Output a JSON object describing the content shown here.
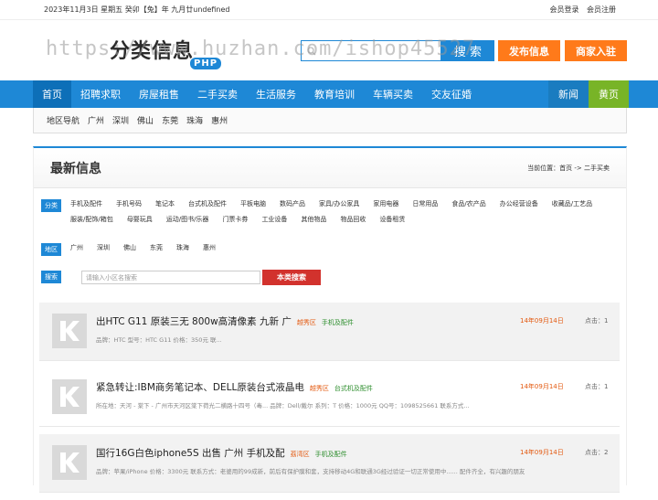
{
  "topbar": {
    "date": "2023年11月3日 星期五 癸卯【兔】年 九月廿undefined",
    "login": "会员登录",
    "register": "会员注册"
  },
  "header": {
    "logo_text": "分类信息",
    "logo_badge": "PHP",
    "watermark": "https://www.huzhan.com/ishop45527",
    "search_btn": "搜 索",
    "post_btn": "发布信息",
    "merchant_btn": "商家入驻"
  },
  "nav": {
    "items": [
      "首页",
      "招聘求职",
      "房屋租售",
      "二手买卖",
      "生活服务",
      "教育培训",
      "车辆买卖",
      "交友征婚"
    ],
    "news": "新闻",
    "home2": "黄页"
  },
  "region_nav": {
    "label": "地区导航",
    "items": [
      "广州",
      "深圳",
      "佛山",
      "东莞",
      "珠海",
      "惠州"
    ]
  },
  "panel": {
    "title": "最新信息",
    "crumb": "当前位置：首页 -> 二手买卖"
  },
  "filters": {
    "cat_tag": "分类",
    "categories": [
      "手机及配件",
      "手机号码",
      "笔记本",
      "台式机及配件",
      "平板电脑",
      "数码产品",
      "家具/办公家具",
      "家用电器",
      "日常用品",
      "食品/农产品",
      "办公经营设备",
      "收藏品/工艺品",
      "服装/配饰/箱包",
      "母婴玩具",
      "运动/图书/乐器",
      "门票卡券",
      "工业设备",
      "其他物品",
      "物品回收",
      "设备租赁"
    ],
    "area_tag": "地区",
    "areas": [
      "广州",
      "深圳",
      "佛山",
      "东莞",
      "珠海",
      "惠州"
    ],
    "search_tag": "搜索",
    "search_placeholder": "请输入小区名搜索",
    "search_btn": "本类搜索"
  },
  "listings": [
    {
      "title": "出HTC G11 原装三无 800w高清像素 九新 广",
      "area": "越秀区",
      "category": "手机及配件",
      "desc": "品牌：HTC 型号：HTC G11 价格：350元 联...",
      "date": "14年09月14日",
      "clicks": "点击：1"
    },
    {
      "title": "紧急转让:IBM商务笔记本、DELL原装台式液晶电",
      "area": "越秀区",
      "category": "台式机及配件",
      "desc": "所在地：天河 - 棠下 - 广州市天河区棠下荷光二横路十四号（毒... 品牌：Dell/戴尔 系列：T 价格：1000元 QQ号：1098525661 联系方式...",
      "date": "14年09月14日",
      "clicks": "点击：1"
    },
    {
      "title": "国行16G白色iphone5S 出售 广州 手机及配",
      "area": "荔湾区",
      "category": "手机及配件",
      "desc": "品牌：苹果/iPhone 价格：3300元 联系方式：老婆用的99成新，前后有保护膜和套，支持移动4G和联通3G经过验证一切正常使用中...... 配件齐全，有兴趣的朋友...",
      "date": "14年09月14日",
      "clicks": "点击：2"
    }
  ],
  "colors": {
    "brand_blue": "#1e88d6",
    "orange": "#ff7a1a",
    "green": "#78b427",
    "red": "#d2322d"
  }
}
